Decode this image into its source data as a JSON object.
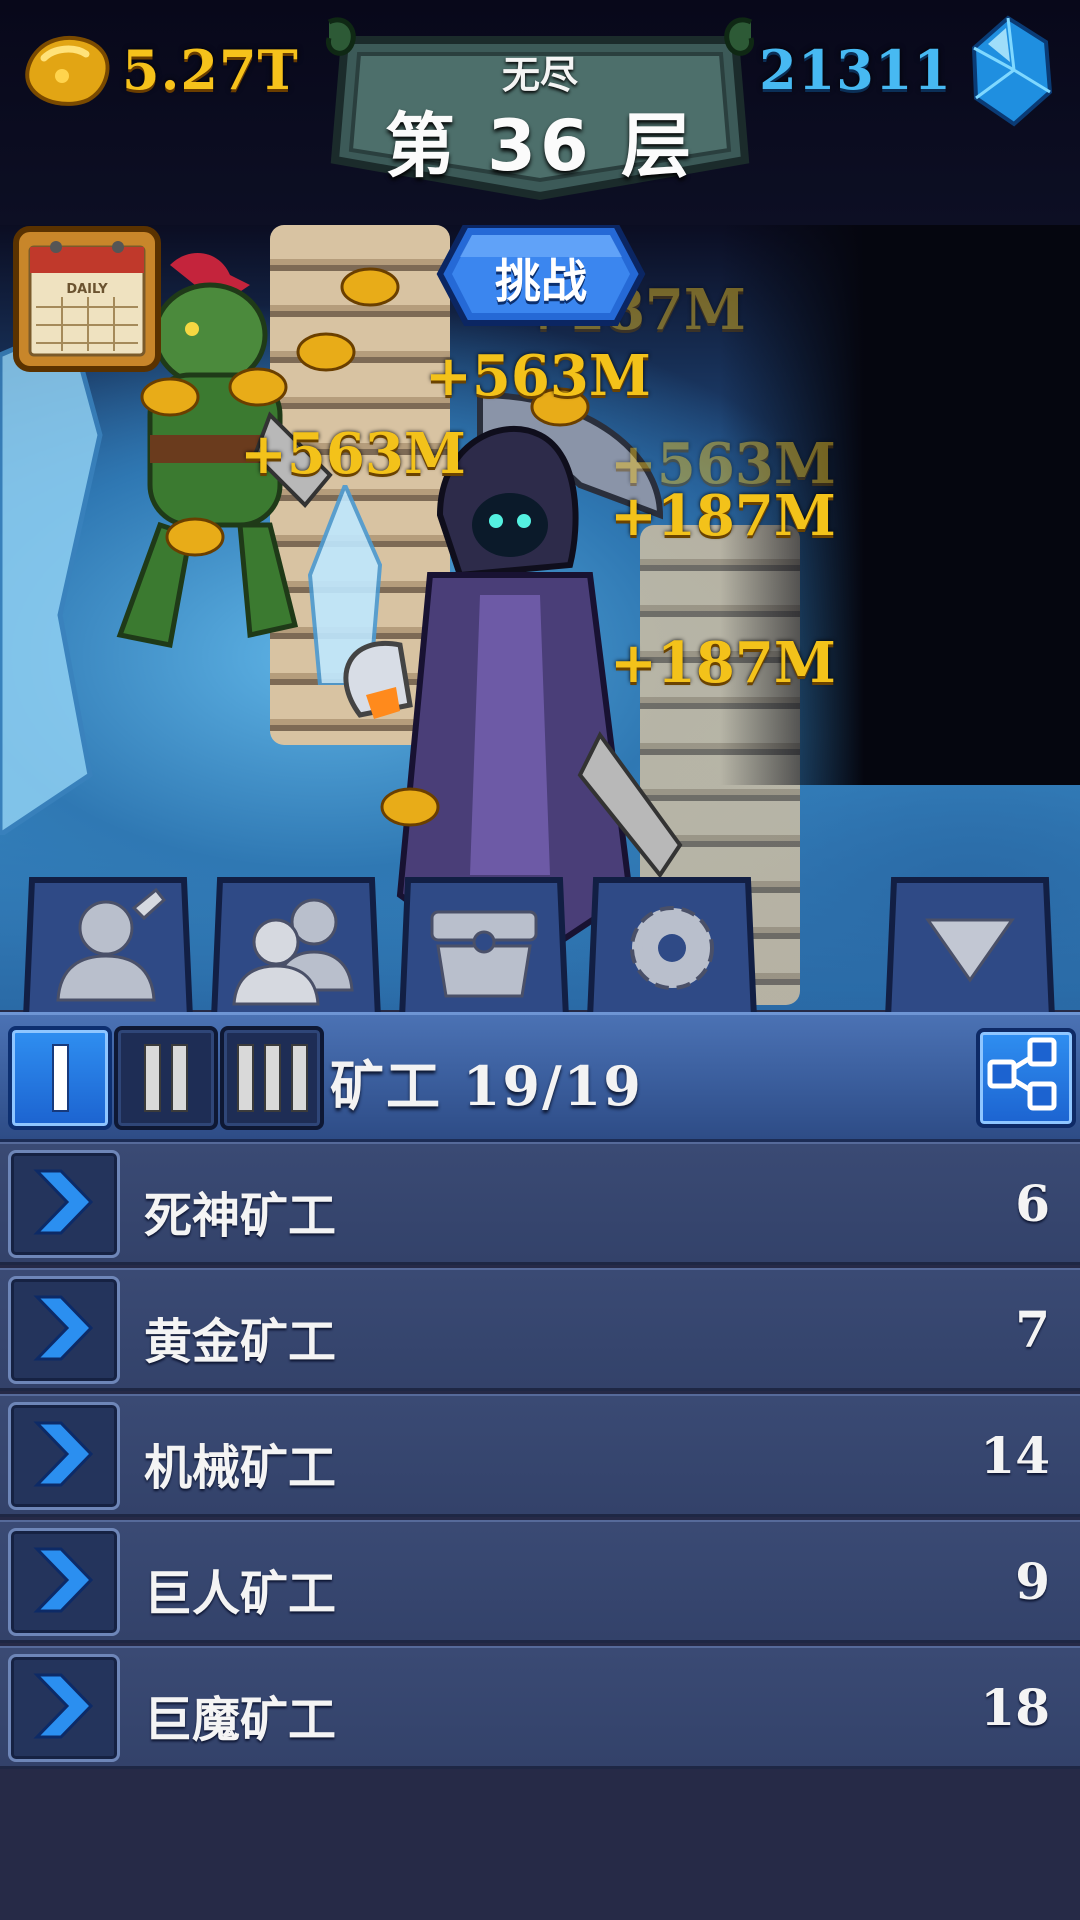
{
  "currency": {
    "gold": "5.27T",
    "gems": "21311"
  },
  "floor": {
    "mode": "无尽",
    "label": "第 36 层"
  },
  "challenge_label": "挑战",
  "calendar_label": "DAILY",
  "floating_rewards": [
    "+187M",
    "+563M",
    "+563M",
    "+563M",
    "+187M",
    "+187M"
  ],
  "panel": {
    "title": "矿工  19/19",
    "tiers": [
      "I",
      "II",
      "III"
    ],
    "active_tier": 0
  },
  "miners": [
    {
      "name": "死神矿工",
      "count": "6"
    },
    {
      "name": "黄金矿工",
      "count": "7"
    },
    {
      "name": "机械矿工",
      "count": "14"
    },
    {
      "name": "巨人矿工",
      "count": "9"
    },
    {
      "name": "巨魔矿工",
      "count": "18"
    }
  ],
  "icons": {
    "gold": "gold-nugget-icon",
    "gems": "blue-crystal-icon",
    "tabs": [
      "single-miner-icon",
      "miner-group-icon",
      "treasure-chest-icon",
      "settings-gear-icon",
      "collapse-triangle-icon"
    ],
    "share": "share-network-icon",
    "row": "chevron-right-icon"
  },
  "colors": {
    "gold_text": "#f6c21b",
    "gem_text": "#47b9f2",
    "active_blue": "#2f8ff1",
    "row_bg": "#33426a"
  }
}
